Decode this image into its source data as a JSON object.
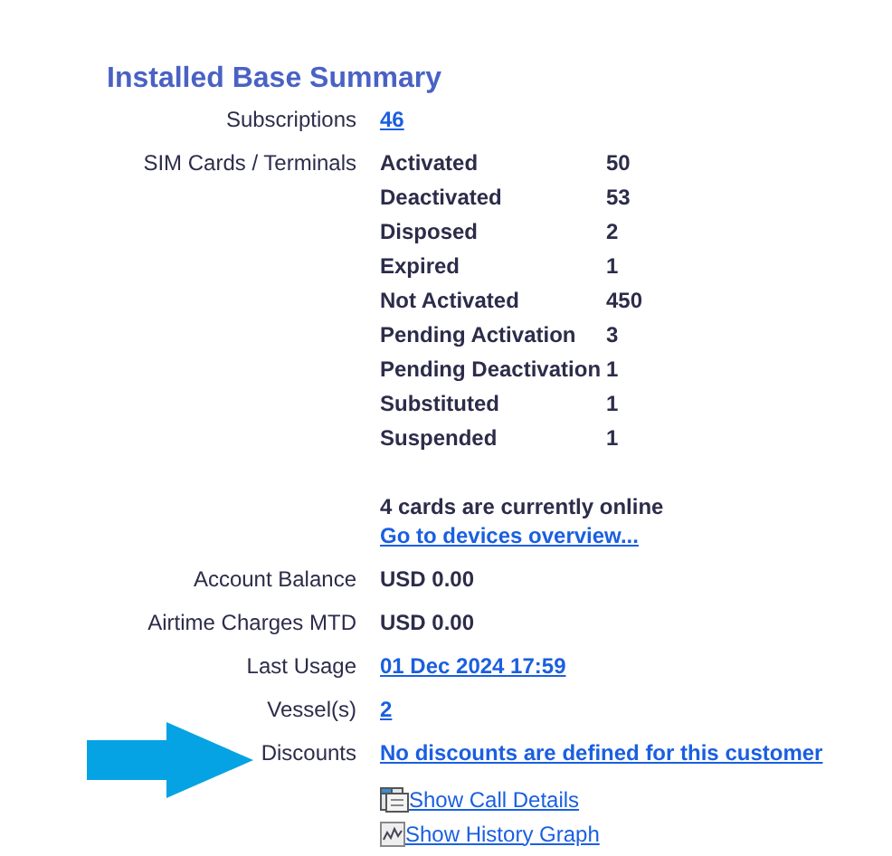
{
  "title": "Installed Base Summary",
  "subscriptions": {
    "label": "Subscriptions",
    "value": "46"
  },
  "sim_cards": {
    "label": "SIM Cards / Terminals",
    "statuses": [
      {
        "name": "Activated",
        "count": "50"
      },
      {
        "name": "Deactivated",
        "count": "53"
      },
      {
        "name": "Disposed",
        "count": "2"
      },
      {
        "name": "Expired",
        "count": "1"
      },
      {
        "name": "Not Activated",
        "count": "450"
      },
      {
        "name": "Pending Activation",
        "count": "3"
      },
      {
        "name": "Pending Deactivation",
        "count": "1"
      },
      {
        "name": "Substituted",
        "count": "1"
      },
      {
        "name": "Suspended",
        "count": "1"
      }
    ],
    "online_note": "4 cards are currently online",
    "devices_link": "Go to devices overview..."
  },
  "fields": [
    {
      "label": "Account Balance",
      "value": "USD 0.00",
      "kind": "text"
    },
    {
      "label": "Airtime Charges MTD",
      "value": "USD 0.00",
      "kind": "text"
    },
    {
      "label": "Last Usage",
      "value": "01 Dec 2024 17:59",
      "kind": "link"
    },
    {
      "label": "Vessel(s)",
      "value": "2",
      "kind": "link"
    },
    {
      "label": "Discounts",
      "value": "No discounts are defined for this customer",
      "kind": "link"
    }
  ],
  "actions": [
    {
      "label": " Show Call Details",
      "kind": "details"
    },
    {
      "label": "Show History Graph",
      "kind": "graph"
    }
  ]
}
